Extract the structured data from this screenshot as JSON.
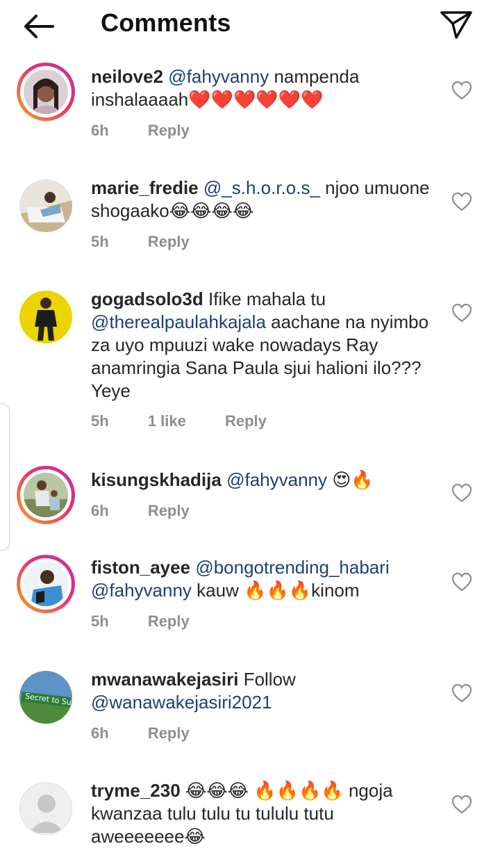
{
  "header": {
    "title": "Comments",
    "back_icon": "arrow-left-icon",
    "share_icon": "paper-plane-icon"
  },
  "comments": [
    {
      "username": "neilove2",
      "mention": "@fahyvanny",
      "text": " nampenda inshalaaaah❤️❤️❤️❤️❤️❤️",
      "time": "6h",
      "likes": "",
      "reply": "Reply",
      "story": true
    },
    {
      "username": "marie_fredie",
      "mention": "@_s.h.o.r.o.s_",
      "text": " njoo umuone shogaako😂😂😂😂",
      "time": "5h",
      "likes": "",
      "reply": "Reply",
      "story": false
    },
    {
      "username": "gogadsolo3d",
      "text_pre": " Ifike mahala tu ",
      "mention": "@therealpaulahkajala",
      "text": " aachane na nyimbo za uyo mpuuzi wake nowadays Ray anamringia Sana Paula sjui halioni ilo??? Yeye",
      "time": "5h",
      "likes": "1 like",
      "reply": "Reply",
      "story": false
    },
    {
      "username": "kisungskhadija",
      "mention": "@fahyvanny",
      "text": " 😍🔥",
      "time": "6h",
      "likes": "",
      "reply": "Reply",
      "story": true
    },
    {
      "username": "fiston_ayee",
      "mention": "@bongotrending_habari",
      "mention2": "@fahyvanny",
      "text": "  kauw 🔥🔥🔥kinom",
      "time": "5h",
      "likes": "",
      "reply": "Reply",
      "story": true
    },
    {
      "username": "mwanawakejasiri",
      "text_pre": " Follow ",
      "mention": "@wanawakejasiri2021",
      "text": "",
      "time": "6h",
      "likes": "",
      "reply": "Reply",
      "story": false,
      "avatar_text": "Secret to Succe"
    },
    {
      "username": "tryme_230",
      "text": " 😂😂😂 🔥🔥🔥🔥 ngoja kwanzaa tulu tulu tu tululu tutu aweeeeeee😂",
      "time": "",
      "likes": "",
      "reply": "",
      "story": false
    }
  ]
}
